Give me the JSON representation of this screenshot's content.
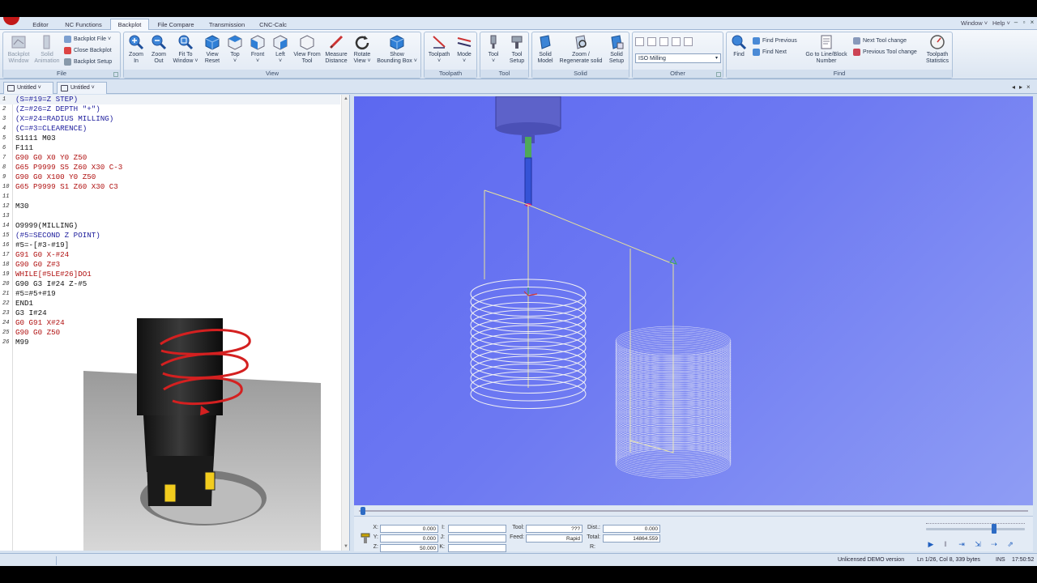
{
  "tabs": [
    "Editor",
    "NC Functions",
    "Backplot",
    "File Compare",
    "Transmission",
    "CNC-Calc"
  ],
  "active_tab": "Backplot",
  "window_menu": {
    "window": "Window ˅",
    "help": "Help ˅"
  },
  "ribbon": {
    "file": {
      "label": "File",
      "backplot_window": "Backplot\nWindow",
      "solid_animation": "Solid\nAnimation",
      "backplot_file": "Backplot File ˅",
      "close_backplot": "Close Backplot",
      "backplot_setup": "Backplot Setup"
    },
    "view": {
      "label": "View",
      "buttons": [
        "Zoom\nIn",
        "Zoom\nOut",
        "Fit To\nWindow ˅",
        "View\nReset",
        "Top\n˅",
        "Front\n˅",
        "Left\n˅",
        "View From\nTool",
        "Measure\nDistance",
        "Rotate\nView ˅",
        "Show\nBounding Box ˅"
      ]
    },
    "toolpath": {
      "label": "Toolpath",
      "buttons": [
        "Toolpath\n˅",
        "Mode\n˅"
      ]
    },
    "tool": {
      "label": "Tool",
      "buttons": [
        "Tool\n˅",
        "Tool\nSetup"
      ]
    },
    "solid": {
      "label": "Solid",
      "buttons": [
        "Solid\nModel",
        "Zoom /\nRegenerate solid",
        "Solid\nSetup"
      ]
    },
    "other": {
      "label": "Other",
      "machine_select": "ISO Milling"
    },
    "find": {
      "label": "Find",
      "find": "Find",
      "find_previous": "Find Previous",
      "find_next": "Find Next",
      "goto_line": "Go to Line/Block\nNumber",
      "next_tool_change": "Next Tool change",
      "previous_tool_change": "Previous Tool change",
      "toolpath_statistics": "Toolpath\nStatistics"
    }
  },
  "documents": [
    "Untitled ˅",
    "Untitled ˅"
  ],
  "code_lines": [
    {
      "n": "1",
      "text": "(S=#19=Z STEP)",
      "style": "comment"
    },
    {
      "n": "2",
      "text": "(Z=#26=Z DEPTH \"+\")",
      "style": "comment"
    },
    {
      "n": "3",
      "text": "(X=#24=RADIUS MILLING)",
      "style": "comment"
    },
    {
      "n": "4",
      "text": "(C=#3=CLEARENCE)",
      "style": "comment"
    },
    {
      "n": "5",
      "text": "S1111 M03",
      "style": "plain"
    },
    {
      "n": "6",
      "text": "F111",
      "style": "plain"
    },
    {
      "n": "7",
      "text": "G90 G0 X0 Y0 Z50",
      "style": "red"
    },
    {
      "n": "8",
      "text": "G65 P9999 S5 Z60 X30 C-3",
      "style": "red"
    },
    {
      "n": "9",
      "text": "G90 G0 X100 Y0 Z50",
      "style": "red"
    },
    {
      "n": "10",
      "text": "G65 P9999 S1 Z60 X30 C3",
      "style": "red"
    },
    {
      "n": "11",
      "text": "",
      "style": "plain"
    },
    {
      "n": "12",
      "text": "M30",
      "style": "plain"
    },
    {
      "n": "13",
      "text": "",
      "style": "plain"
    },
    {
      "n": "14",
      "text": "O9999(MILLING)",
      "style": "plain"
    },
    {
      "n": "15",
      "text": "(#5=SECOND Z POINT)",
      "style": "comment"
    },
    {
      "n": "16",
      "text": "#5=-[#3-#19]",
      "style": "plain"
    },
    {
      "n": "17",
      "text": "G91 G0 X-#24",
      "style": "red"
    },
    {
      "n": "18",
      "text": "G90 G0 Z#3",
      "style": "red"
    },
    {
      "n": "19",
      "text": "WHILE[#5LE#26]DO1",
      "style": "red"
    },
    {
      "n": "20",
      "text": "G90 G3 I#24 Z-#5",
      "style": "plain"
    },
    {
      "n": "21",
      "text": "#5=#5+#19",
      "style": "plain"
    },
    {
      "n": "22",
      "text": "END1",
      "style": "plain"
    },
    {
      "n": "23",
      "text": "G3 I#24",
      "style": "plain"
    },
    {
      "n": "24",
      "text": "G0 G91 X#24",
      "style": "red"
    },
    {
      "n": "25",
      "text": "G90 G0 Z50",
      "style": "red"
    },
    {
      "n": "26",
      "text": "M99",
      "style": "plain"
    }
  ],
  "readout": {
    "x_label": "X:",
    "x": "0.000",
    "y_label": "Y:",
    "y": "0.000",
    "z_label": "Z:",
    "z": "50.000",
    "i_label": "I:",
    "j_label": "J:",
    "k_label": "K:",
    "tool_label": "Tool:",
    "tool": "???",
    "feed_label": "Feed:",
    "feed": "Rapid",
    "dist_label": "Dist.:",
    "dist": "0.000",
    "total_label": "Total:",
    "total": "14864.559",
    "r_label": "R:"
  },
  "progress": 0.0,
  "speed_level": 0.7,
  "status": {
    "license": "Unlicensed DEMO version",
    "position": "Ln 1/26, Col 8, 339 bytes",
    "mode": "INS",
    "time": "17:50:52"
  },
  "colors": {
    "accent": "#2d6bc4",
    "viewport_top": "#5c68f0",
    "code_red": "#b01010",
    "code_blue": "#1c1c9c"
  }
}
